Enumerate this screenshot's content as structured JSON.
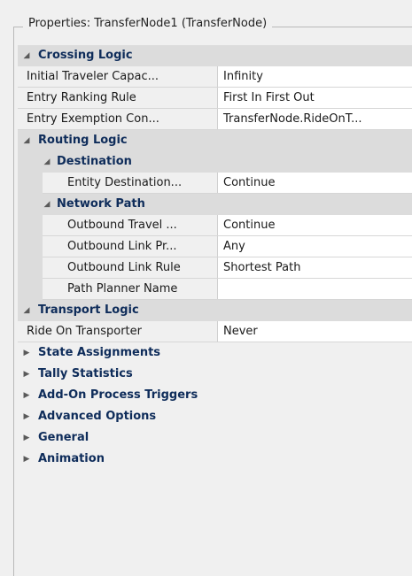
{
  "panel": {
    "title": "Properties: TransferNode1 (TransferNode)"
  },
  "crossing_logic": {
    "label": "Crossing Logic",
    "rows": [
      {
        "name": "Initial Traveler Capac...",
        "value": "Infinity"
      },
      {
        "name": "Entry Ranking Rule",
        "value": "First In First Out"
      },
      {
        "name": "Entry Exemption Con...",
        "value": "TransferNode.RideOnT..."
      }
    ]
  },
  "routing_logic": {
    "label": "Routing Logic",
    "destination": {
      "label": "Destination",
      "rows": [
        {
          "name": "Entity Destination...",
          "value": "Continue"
        }
      ]
    },
    "network_path": {
      "label": "Network Path",
      "rows": [
        {
          "name": "Outbound Travel ...",
          "value": "Continue"
        },
        {
          "name": "Outbound Link Pr...",
          "value": "Any"
        },
        {
          "name": "Outbound Link Rule",
          "value": "Shortest Path"
        },
        {
          "name": "Path Planner Name",
          "value": ""
        }
      ]
    }
  },
  "transport_logic": {
    "label": "Transport Logic",
    "rows": [
      {
        "name": "Ride On Transporter",
        "value": "Never"
      }
    ]
  },
  "collapsed_categories": [
    "State Assignments",
    "Tally Statistics",
    "Add-On Process Triggers",
    "Advanced Options",
    "General",
    "Animation"
  ],
  "icons": {
    "expanded": "triangle-down-icon",
    "collapsed": "triangle-right-icon"
  }
}
